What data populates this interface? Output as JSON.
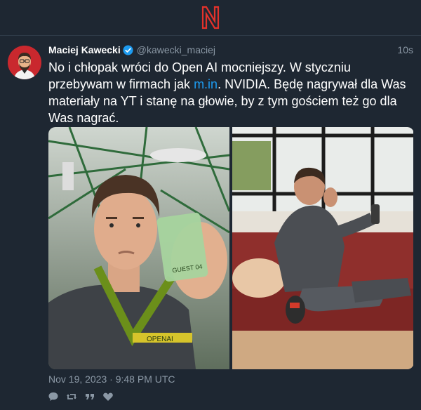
{
  "app": {
    "logo_icon": "n-logo-icon",
    "accent": "#e4322b"
  },
  "post": {
    "author": "Maciej Kawecki",
    "handle": "@kawecki_maciej",
    "time_ago": "10s",
    "verified_icon": "verified-badge-icon",
    "text_part1": "No i chłopak wróci do Open AI mocniejszy. W styczniu przebywam w firmach jak ",
    "link_text": "m.in",
    "text_part2": ". NVIDIA. Będę nagrywał dla Was materiały na YT i stanę na głowie, by z tym gościem też go dla Was nagrać.",
    "link_color": "#1d9bf0",
    "date": "Nov 19, 2023 · 9:48 PM UTC",
    "photos": [
      {
        "icon": "photo-man-with-badge"
      },
      {
        "icon": "photo-man-on-sofa"
      }
    ],
    "badge_text": "GUEST 04",
    "lanyard_text": "OPENAI",
    "actions": [
      {
        "name": "reply-icon"
      },
      {
        "name": "retweet-icon"
      },
      {
        "name": "quote-icon"
      },
      {
        "name": "like-icon"
      }
    ]
  }
}
